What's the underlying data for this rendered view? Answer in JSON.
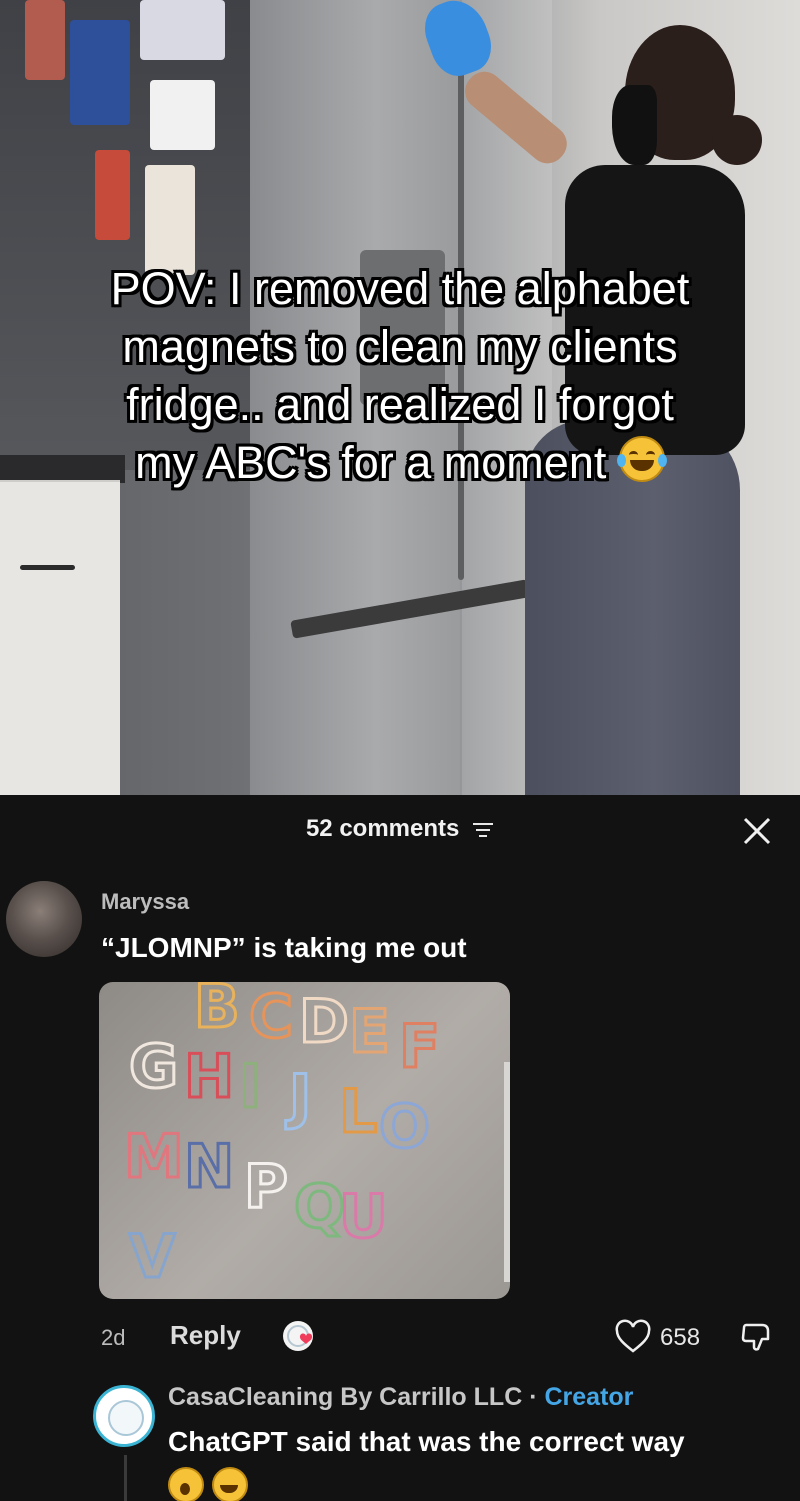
{
  "video": {
    "caption_lines": [
      "POV: I removed the alphabet",
      "magnets to clean my clients",
      "fridge.. and realized I forgot",
      "my ABC's for a moment"
    ],
    "caption_emoji": "laughing-with-tears-emoji"
  },
  "comments_panel": {
    "count_label": "52 comments",
    "filter_icon": "filter-lines-icon",
    "close_icon": "close-x-icon"
  },
  "comment": {
    "author": "Maryssa",
    "text": "“JLOMNP” is taking me out",
    "image_letters": [
      "B",
      "C",
      "D",
      "E",
      "F",
      "G",
      "H",
      "I",
      "J",
      "L",
      "O",
      "M",
      "N",
      "P",
      "Q",
      "U",
      "V"
    ],
    "time": "2d",
    "reply_label": "Reply",
    "likes": "658",
    "creator_liked_icon": "creator-liked-avatar-heart-icon"
  },
  "reply": {
    "author": "CasaCleaning By Carrillo LLC",
    "separator": "·",
    "badge": "Creator",
    "text": "ChatGPT said that was the correct way",
    "emojis": [
      "face-with-hand-over-mouth-emoji",
      "laughing-with-tears-emoji"
    ]
  },
  "colors": {
    "panel_bg": "#121212",
    "creator_badge": "#45a6e6",
    "avatar_ring": "#3bb4d4",
    "glove": "#3a8ee0"
  }
}
